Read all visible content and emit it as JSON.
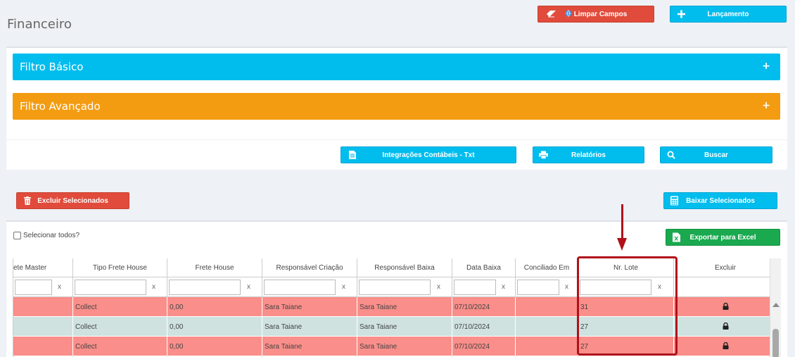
{
  "page": {
    "title": "Financeiro"
  },
  "top_buttons": {
    "clear_label": "Limpar Campos",
    "launch_label": "Lançamento"
  },
  "filters": {
    "basic_label": "Filtro Básico",
    "advanced_label": "Filtro Avançado",
    "expand_symbol": "+"
  },
  "actions": {
    "integrations_label": "Integrações Contábeis - Txt",
    "reports_label": "Relatórios",
    "search_label": "Buscar"
  },
  "bulk": {
    "delete_label": "Excluir Selecionados",
    "settle_label": "Baixar Selecionados",
    "export_label": "Exportar para Excel",
    "select_all_label": "Selecionar todos?"
  },
  "grid": {
    "columns": [
      "ete Master",
      "Tipo Frete House",
      "Frete House",
      "Responsável Criação",
      "Responsável Baixa",
      "Data Baixa",
      "Conciliado Em",
      "Nr. Lote",
      "Excluir"
    ],
    "filter_clear_symbol": "x",
    "rows": [
      {
        "status": "red",
        "tipo_frete_house": "Collect",
        "frete_house": "0,00",
        "resp_criacao": "Sara Taiane",
        "resp_baixa": "Sara Taiane",
        "data_baixa": "07/10/2024",
        "conciliado_em": "",
        "nr_lote": "31"
      },
      {
        "status": "teal",
        "tipo_frete_house": "Collect",
        "frete_house": "0,00",
        "resp_criacao": "Sara Taiane",
        "resp_baixa": "Sara Taiane",
        "data_baixa": "07/10/2024",
        "conciliado_em": "",
        "nr_lote": "27"
      },
      {
        "status": "red",
        "tipo_frete_house": "Collect",
        "frete_house": "0,00",
        "resp_criacao": "Sara Taiane",
        "resp_baixa": "Sara Taiane",
        "data_baixa": "07/10/2024",
        "conciliado_em": "",
        "nr_lote": "27"
      }
    ]
  },
  "icons": [
    "eraser-icon",
    "globe-icon",
    "plus-icon",
    "document-icon",
    "print-icon",
    "search-icon",
    "trash-icon",
    "calculator-icon",
    "excel-icon",
    "lock-icon"
  ],
  "colors": {
    "row_red": "#fa8e8a",
    "row_teal": "#cfe2e0",
    "accent_blue": "#00bdee",
    "accent_orange": "#f39c12",
    "danger": "#e04b3b",
    "success": "#1aa94f",
    "annotation": "#b0111b"
  }
}
